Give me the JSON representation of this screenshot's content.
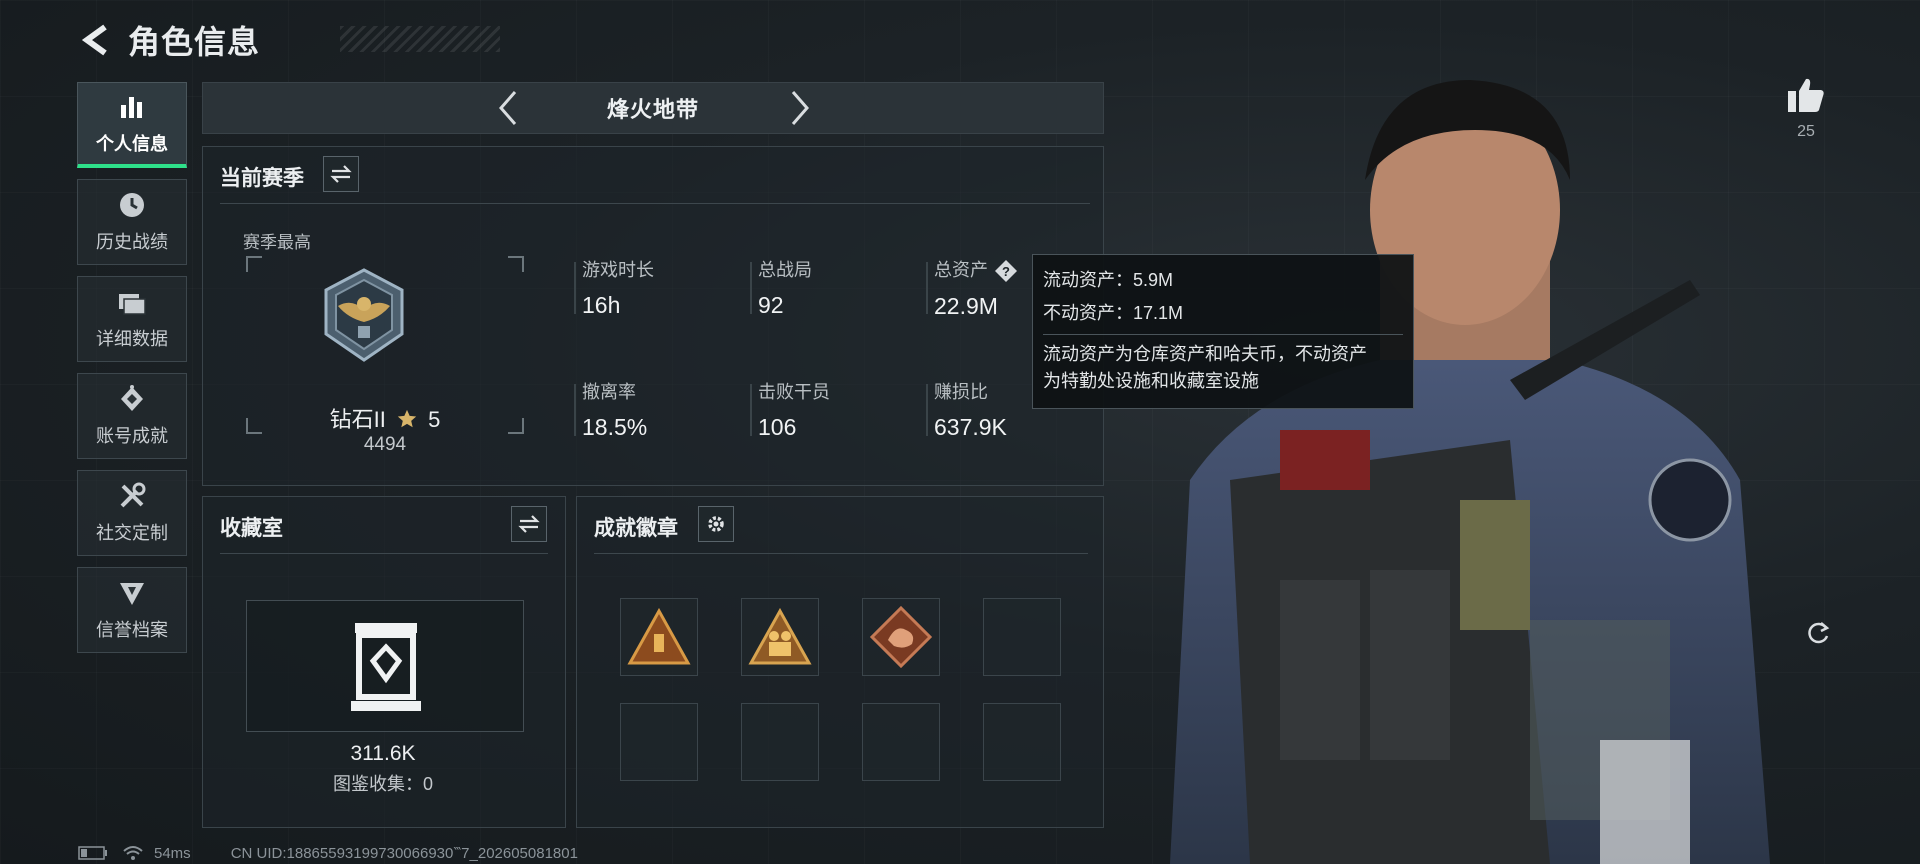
{
  "header": {
    "title": "角色信息"
  },
  "sidebar": {
    "items": [
      {
        "label": "个人信息",
        "icon": "bar-chart-icon",
        "active": true
      },
      {
        "label": "历史战绩",
        "icon": "clock-icon"
      },
      {
        "label": "详细数据",
        "icon": "folder-icon"
      },
      {
        "label": "账号成就",
        "icon": "achievement-icon"
      },
      {
        "label": "社交定制",
        "icon": "tools-icon"
      },
      {
        "label": "信誉档案",
        "icon": "reputation-icon"
      }
    ]
  },
  "mode": {
    "title": "烽火地带"
  },
  "season": {
    "title": "当前赛季",
    "subtitle": "赛季最高",
    "rank_name": "钻石II",
    "rank_stars": "5",
    "rank_score": "4494",
    "stats": [
      {
        "label": "游戏时长",
        "value": "16h"
      },
      {
        "label": "总战局",
        "value": "92"
      },
      {
        "label": "总资产",
        "value": "22.9M"
      },
      {
        "label": "撤离率",
        "value": "18.5%"
      },
      {
        "label": "击败干员",
        "value": "106"
      },
      {
        "label": "赚损比",
        "value": "637.9K"
      }
    ]
  },
  "tooltip": {
    "liquid": "流动资产：5.9M",
    "fixed": "不动资产：17.1M",
    "desc_line1": "流动资产为仓库资产和哈夫币，不动资产",
    "desc_line2": "为特勤处设施和收藏室设施"
  },
  "collection": {
    "title": "收藏室",
    "value": "311.6K",
    "sub": "图鉴收集：0"
  },
  "badges": {
    "title": "成就徽章"
  },
  "like": {
    "count": "25"
  },
  "status": {
    "ping": "54ms",
    "uid": "CN UID:18865593199730066930‷7_202605081801"
  },
  "colors": {
    "accent": "#2ee08a",
    "panel_bg": "#1e2529",
    "tooltip_bg": "#0e1214"
  }
}
